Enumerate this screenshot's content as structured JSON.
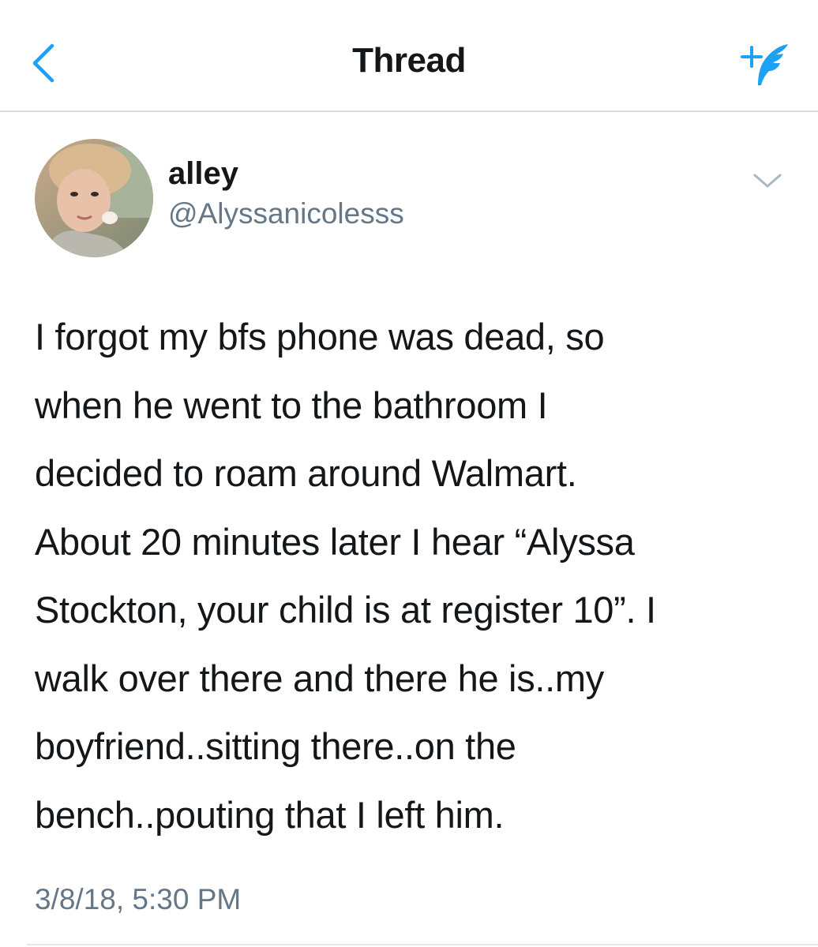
{
  "header": {
    "title": "Thread",
    "back_icon": "chevron-left-icon",
    "compose_icon": "compose-tweet-icon",
    "accent_color": "#1da1f2"
  },
  "tweet": {
    "display_name": "alley",
    "handle": "@Alyssanicolesss",
    "text": "I forgot my bfs phone was dead, so\nwhen he went to the bathroom I\ndecided to roam around Walmart.\nAbout 20 minutes later I hear “Alyssa\nStockton, your child is at register 10”. I\nwalk over there and there he is..my\nboyfriend..sitting there..on the\nbench..pouting that I left him.",
    "timestamp": "3/8/18, 5:30 PM",
    "more_icon": "chevron-down-icon",
    "avatar": "avatar-photo"
  },
  "colors": {
    "text_primary": "#14171a",
    "text_secondary": "#657786",
    "divider": "#d8dde1"
  }
}
